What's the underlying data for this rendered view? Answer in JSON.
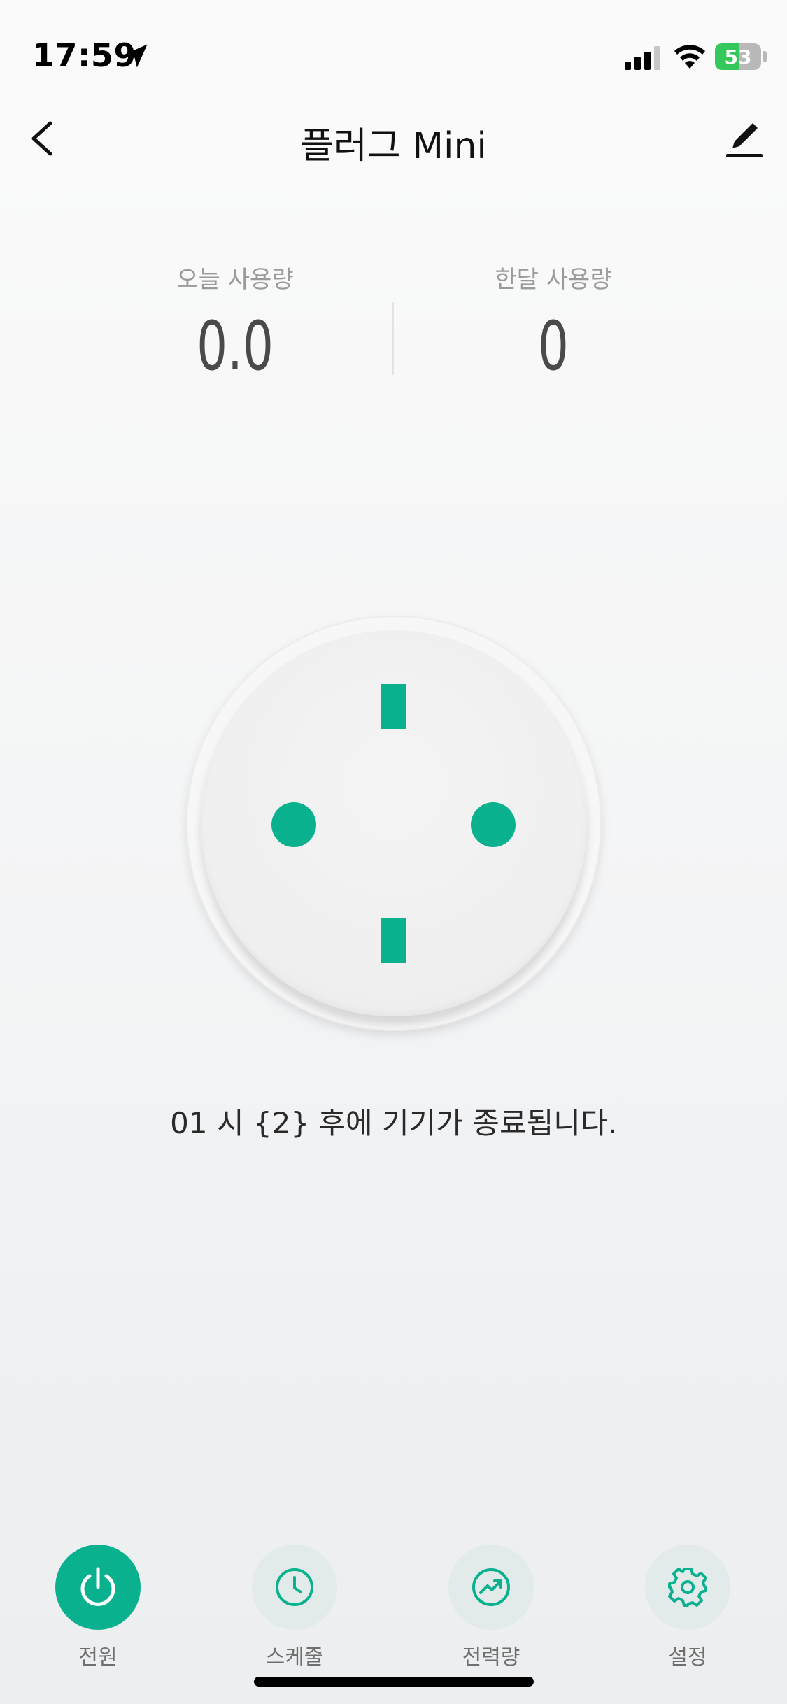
{
  "status_bar": {
    "time": "17:59",
    "battery": "53",
    "battery_level": 0.53,
    "icons": [
      "location-arrow-icon",
      "cellular-signal-icon",
      "wifi-icon",
      "battery-charging-icon"
    ]
  },
  "nav": {
    "title": "플러그 Mini",
    "back_icon": "chevron-left-icon",
    "edit_icon": "pencil-icon"
  },
  "usage": {
    "today_label": "오늘 사용량",
    "today_value": "0.0",
    "month_label": "한달 사용량",
    "month_value": "0"
  },
  "socket": {
    "accent_color": "#0ab18f"
  },
  "timer_message": "01 시  {2} 후에 기기가 종료됩니다.",
  "tabs": [
    {
      "label": "전원",
      "icon": "power-icon",
      "active": true
    },
    {
      "label": "스케줄",
      "icon": "clock-icon",
      "active": false
    },
    {
      "label": "전력량",
      "icon": "trend-chart-icon",
      "active": false
    },
    {
      "label": "설정",
      "icon": "gear-icon",
      "active": false
    }
  ],
  "colors": {
    "accent": "#0ab18f",
    "tab_inactive_bg": "#e2eaea",
    "battery_green": "#34c759"
  }
}
